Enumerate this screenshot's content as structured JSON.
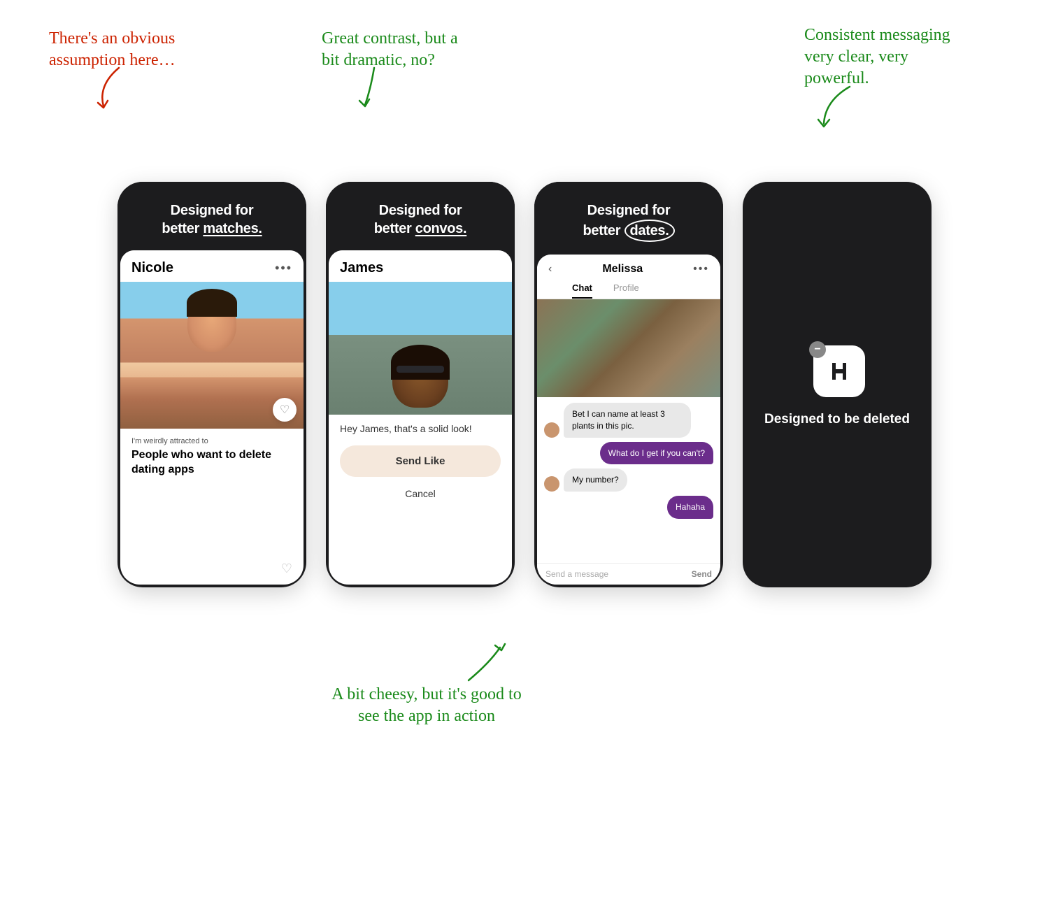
{
  "page": {
    "background": "#ffffff"
  },
  "annotations": {
    "top_left": {
      "text": "There's an obvious assumption here…",
      "color": "red",
      "style": "handwriting"
    },
    "top_center": {
      "text": "Great contrast, but a bit dramatic, no?",
      "color": "green",
      "style": "handwriting"
    },
    "top_right": {
      "text": "Consistent messaging very clear, very powerful.",
      "color": "green",
      "style": "handwriting"
    },
    "bottom_center": {
      "text": "A bit cheesy, but it's good to see the app in action",
      "color": "green",
      "style": "handwriting"
    }
  },
  "phones": [
    {
      "id": "phone1",
      "header": "Designed for better matches.",
      "header_emphasis": "matches",
      "emphasis_style": "underline",
      "screen": {
        "name": "Nicole",
        "bio_small": "I'm weirdly attracted to",
        "bio_large": "People who want to delete dating apps"
      }
    },
    {
      "id": "phone2",
      "header": "Designed for better convos.",
      "header_emphasis": "convos",
      "emphasis_style": "underline",
      "screen": {
        "name": "James",
        "compliment": "Hey James, that's a solid look!",
        "send_label": "Send Like",
        "cancel_label": "Cancel"
      }
    },
    {
      "id": "phone3",
      "header": "Designed for better dates.",
      "header_emphasis": "dates",
      "emphasis_style": "circle",
      "screen": {
        "name": "Melissa",
        "tabs": [
          "Chat",
          "Profile"
        ],
        "active_tab": "Chat",
        "messages": [
          {
            "type": "received",
            "text": "Bet I can name at least 3 plants in this pic."
          },
          {
            "type": "sent",
            "text": "What do I get if you can't?"
          },
          {
            "type": "received",
            "text": "My number?"
          },
          {
            "type": "sent",
            "text": "Hahaha"
          }
        ],
        "input_placeholder": "Send a message",
        "send_label": "Send"
      }
    },
    {
      "id": "phone4",
      "header": "",
      "screen": {
        "tagline": "Designed to be deleted",
        "app_icon": "H"
      }
    }
  ]
}
